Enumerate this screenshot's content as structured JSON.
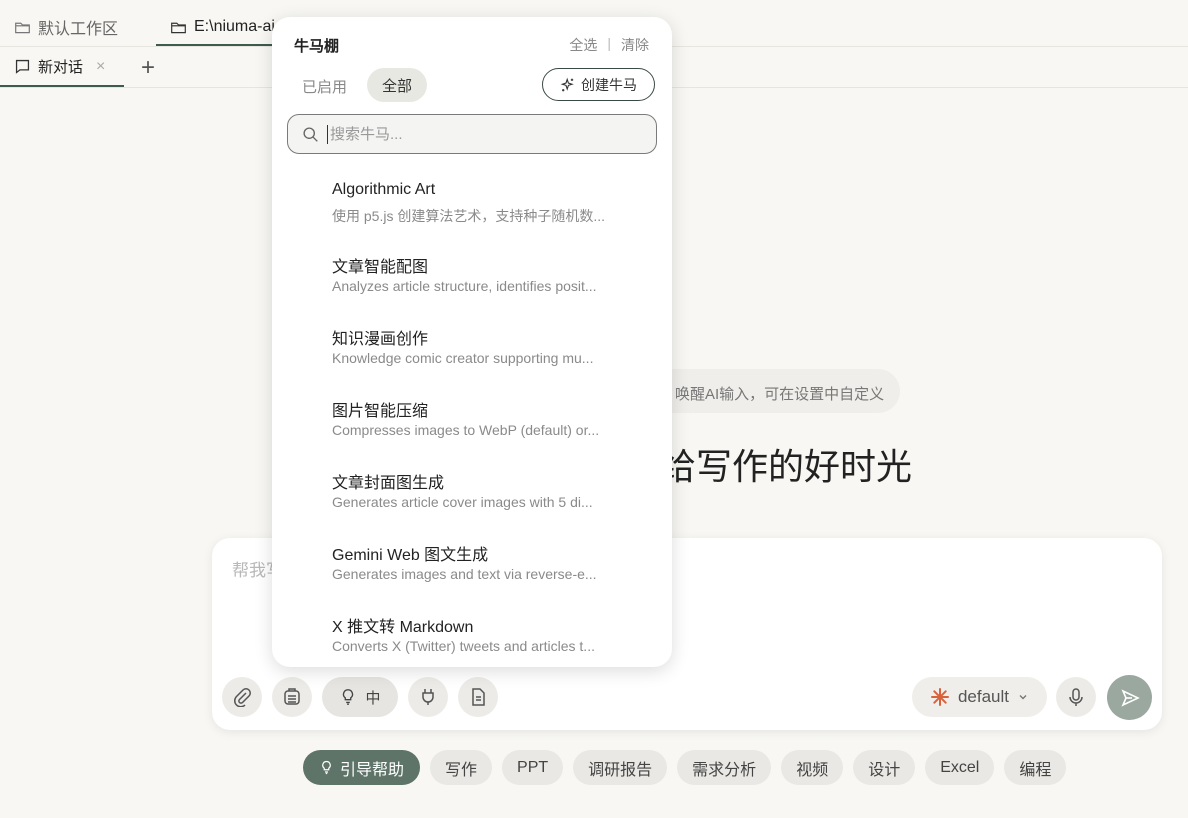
{
  "workspace_tabs": [
    {
      "label": "默认工作区",
      "active": false
    },
    {
      "label": "E:\\niuma-ai",
      "active": true
    }
  ],
  "conversation_tab": {
    "label": "新对话",
    "close": "×",
    "add": "+"
  },
  "background": {
    "hint": "唤醒AI输入，可在设置中自定义",
    "hero": "给写作的好时光"
  },
  "input": {
    "placeholder": "帮我写",
    "think_level": "中",
    "model": "default"
  },
  "chips": [
    "引导帮助",
    "写作",
    "PPT",
    "调研报告",
    "需求分析",
    "视频",
    "设计",
    "Excel",
    "编程"
  ],
  "panel": {
    "title": "牛马棚",
    "select_all": "全选",
    "separator": "|",
    "clear": "清除",
    "filter_enabled": "已启用",
    "filter_all": "全部",
    "create_button": "创建牛马",
    "search_placeholder": "搜索牛马...",
    "skills": [
      {
        "name": "Algorithmic Art",
        "desc": "使用 p5.js 创建算法艺术，支持种子随机数..."
      },
      {
        "name": "文章智能配图",
        "desc": "Analyzes article structure, identifies posit..."
      },
      {
        "name": "知识漫画创作",
        "desc": "Knowledge comic creator supporting mu..."
      },
      {
        "name": "图片智能压缩",
        "desc": "Compresses images to WebP (default) or..."
      },
      {
        "name": "文章封面图生成",
        "desc": "Generates article cover images with 5 di..."
      },
      {
        "name": "Gemini Web 图文生成",
        "desc": "Generates images and text via reverse-e..."
      },
      {
        "name": "X 推文转 Markdown",
        "desc": "Converts X (Twitter) tweets and articles t..."
      }
    ]
  },
  "icons": {
    "folder": "folder-icon",
    "chat": "chat-icon",
    "search": "search-icon",
    "sparkle": "sparkle-icon",
    "paperclip": "paperclip-icon",
    "library": "library-icon",
    "bulb": "lightbulb-icon",
    "plug": "plug-icon",
    "document": "document-icon",
    "model": "asterisk-icon",
    "mic": "microphone-icon",
    "send": "send-icon"
  },
  "colors": {
    "accent": "#5e7468",
    "send": "#9aa89f",
    "model_icon": "#d9623b"
  }
}
